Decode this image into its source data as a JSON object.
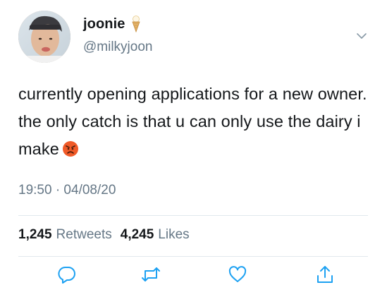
{
  "author": {
    "display_name": "joonie",
    "handle": "@milkyjoon",
    "name_emoji": "ice-cream-icon",
    "avatar": "avatar-photo"
  },
  "tweet": {
    "text": "currently opening applications for a new owner. the only catch is that u can only use the dairy i make",
    "trailing_emoji": "angry-face-icon",
    "timestamp": "19:50 · 04/08/20"
  },
  "stats": {
    "retweets_count": "1,245",
    "retweets_label": "Retweets",
    "likes_count": "4,245",
    "likes_label": "Likes"
  },
  "actions": [
    "reply-icon",
    "retweet-icon",
    "like-icon",
    "share-icon"
  ],
  "colors": {
    "text": "#14171a",
    "secondary": "#657786",
    "icon": "#1da1f2",
    "divider": "#e1e8ed"
  }
}
